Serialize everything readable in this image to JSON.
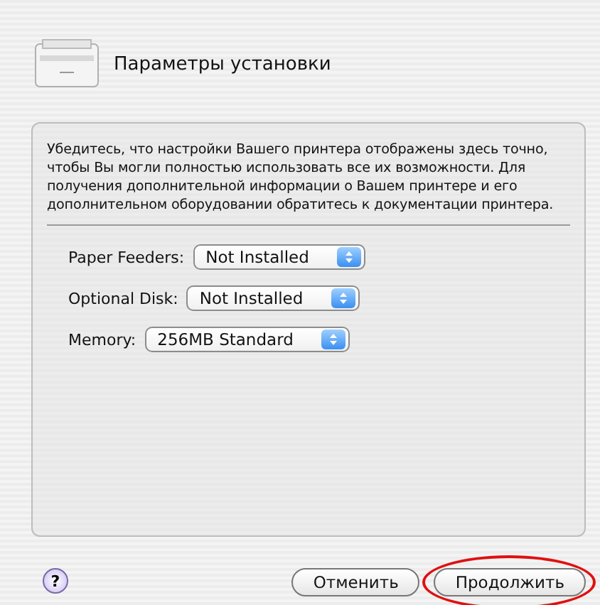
{
  "sheet": {
    "title": "Параметры установки"
  },
  "description": "Убедитесь, что настройки Вашего принтера отображены здесь точно, чтобы Вы могли полностью использовать все их возможности. Для получения дополнительной информации о Вашем принтере и его дополнительном оборудовании обратитесь к документации принтера.",
  "options": [
    {
      "label": "Paper Feeders:",
      "value": "Not Installed"
    },
    {
      "label": "Optional Disk:",
      "value": "Not Installed"
    },
    {
      "label": "Memory:",
      "value": "256MB Standard"
    }
  ],
  "buttons": [
    {
      "label": "Отменить",
      "highlighted": false
    },
    {
      "label": "Продолжить",
      "highlighted": true
    }
  ],
  "help": "?"
}
